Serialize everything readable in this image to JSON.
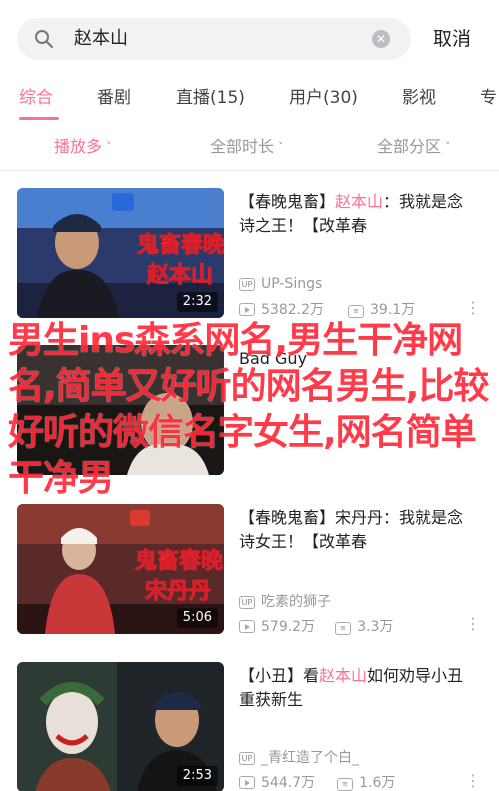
{
  "search": {
    "query": "赵本山",
    "cancel_label": "取消"
  },
  "tabs": [
    {
      "label": "综合",
      "active": true
    },
    {
      "label": "番剧",
      "active": false
    },
    {
      "label": "直播(15)",
      "active": false
    },
    {
      "label": "用户(30)",
      "active": false
    },
    {
      "label": "影视",
      "active": false
    },
    {
      "label": "专",
      "active": false
    }
  ],
  "filters": [
    {
      "label": "播放多",
      "active": true
    },
    {
      "label": "全部时长",
      "active": false
    },
    {
      "label": "全部分区",
      "active": false
    }
  ],
  "videos": [
    {
      "title_pre": "【春晚鬼畜】",
      "title_hl": "赵本山",
      "title_post": "：我就是念诗之王！【改革春",
      "author": "UP-Sings",
      "plays": "5382.2万",
      "danmaku": "39.1万",
      "duration": "2:32",
      "thumb_text_1": "鬼畜春晚",
      "thumb_text_2": "赵本山"
    },
    {
      "title_pre": "",
      "title_hl": "",
      "title_post": "Bad Guy",
      "author": "",
      "plays": "",
      "danmaku": "",
      "duration": "",
      "thumb_text_1": "",
      "thumb_text_2": ""
    },
    {
      "title_pre": "【春晚鬼畜】",
      "title_hl": "",
      "title_post": "宋丹丹：我就是念诗女王！【改革春",
      "author": "吃素的狮子",
      "plays": "579.2万",
      "danmaku": "3.3万",
      "duration": "5:06",
      "thumb_text_1": "鬼畜春晚",
      "thumb_text_2": "宋丹丹"
    },
    {
      "title_pre": "【小丑】看",
      "title_hl": "赵本山",
      "title_post": "如何劝导小丑重获新生",
      "author": "_青红造了个白_",
      "plays": "544.7万",
      "danmaku": "1.6万",
      "duration": "2:53",
      "thumb_text_1": "",
      "thumb_text_2": ""
    }
  ],
  "watermark": "男生ins森系网名,男生干净网名,简单又好听的网名男生,比较好听的微信名字女生,网名简单干净男",
  "colors": {
    "accent": "#fb7299",
    "watermark": "#ff2a3a"
  },
  "icons": {
    "search": "search-icon",
    "clear": "clear-icon",
    "up": "up-icon",
    "play": "play-count-icon",
    "danmaku": "danmaku-icon",
    "more": "more-icon"
  }
}
